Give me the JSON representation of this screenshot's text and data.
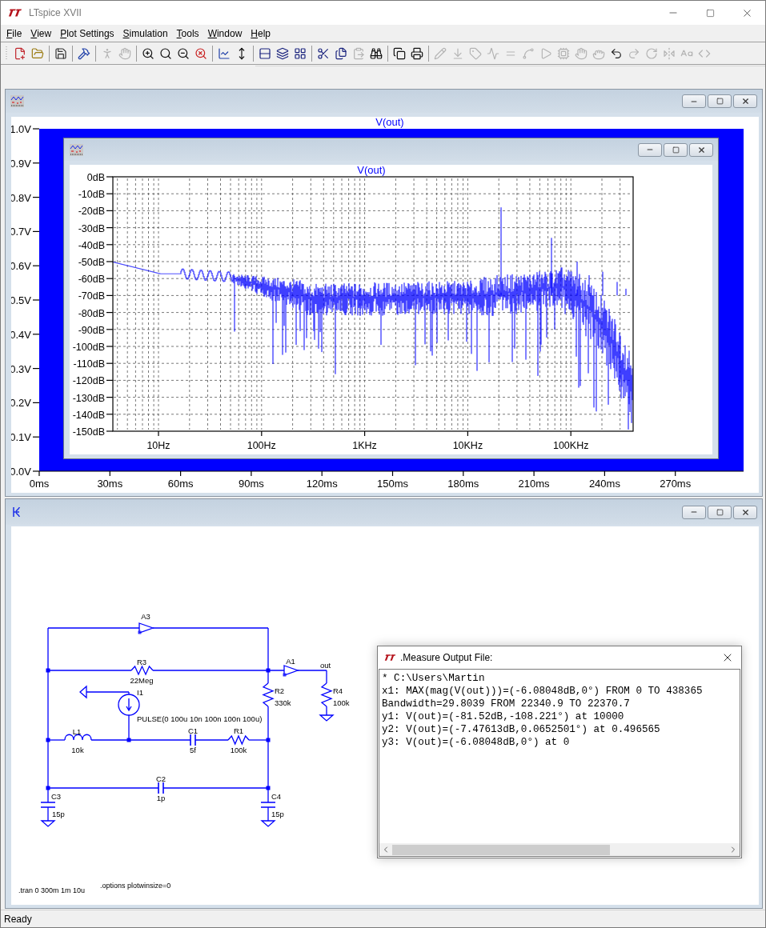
{
  "title_bar": {
    "title": "LTspice XVII"
  },
  "menu": [
    "File",
    "View",
    "Plot Settings",
    "Simulation",
    "Tools",
    "Window",
    "Help"
  ],
  "toolbar": [
    [
      {
        "kind": "new",
        "disabled": false
      },
      {
        "kind": "open",
        "disabled": false
      }
    ],
    [
      {
        "kind": "save",
        "disabled": false
      }
    ],
    [
      {
        "kind": "control-panel",
        "disabled": false
      }
    ],
    [
      {
        "kind": "run",
        "disabled": true
      },
      {
        "kind": "halt",
        "disabled": true
      }
    ],
    [
      {
        "kind": "zoom-in",
        "disabled": false
      },
      {
        "kind": "zoom-fit",
        "disabled": false
      },
      {
        "kind": "zoom-out",
        "disabled": false
      },
      {
        "kind": "zoom-cancel",
        "disabled": false
      }
    ],
    [
      {
        "kind": "add-trace",
        "disabled": false
      },
      {
        "kind": "autorange",
        "disabled": false
      }
    ],
    [
      {
        "kind": "tile",
        "disabled": false
      },
      {
        "kind": "cascade",
        "disabled": false
      },
      {
        "kind": "arrange",
        "disabled": false
      }
    ],
    [
      {
        "kind": "cut",
        "disabled": false
      },
      {
        "kind": "copy",
        "disabled": false
      },
      {
        "kind": "paste",
        "disabled": true
      },
      {
        "kind": "find",
        "disabled": false
      }
    ],
    [
      {
        "kind": "print-preview",
        "disabled": false
      },
      {
        "kind": "print",
        "disabled": false
      }
    ],
    [
      {
        "kind": "wire",
        "disabled": true
      },
      {
        "kind": "ground",
        "disabled": true
      },
      {
        "kind": "label",
        "disabled": true
      },
      {
        "kind": "resistor",
        "disabled": true
      },
      {
        "kind": "capacitor",
        "disabled": true
      },
      {
        "kind": "inductor",
        "disabled": true
      },
      {
        "kind": "diode",
        "disabled": true
      },
      {
        "kind": "component",
        "disabled": true
      },
      {
        "kind": "move",
        "disabled": true
      },
      {
        "kind": "drag",
        "disabled": true
      },
      {
        "kind": "undo",
        "disabled": false
      },
      {
        "kind": "redo",
        "disabled": true
      },
      {
        "kind": "rotate",
        "disabled": true
      },
      {
        "kind": "mirror",
        "disabled": true
      },
      {
        "kind": "text",
        "disabled": true
      },
      {
        "kind": "directive",
        "disabled": true
      }
    ]
  ],
  "plot_window": {
    "trace_label": "V(out)",
    "y_ticks": [
      "1.0V",
      "0.9V",
      "0.8V",
      "0.7V",
      "0.6V",
      "0.5V",
      "0.4V",
      "0.3V",
      "0.2V",
      "0.1V",
      "0.0V"
    ],
    "x_ticks": [
      "0ms",
      "30ms",
      "60ms",
      "90ms",
      "120ms",
      "150ms",
      "180ms",
      "210ms",
      "240ms",
      "270ms"
    ]
  },
  "fft_window": {
    "trace_label": "V(out)",
    "y_ticks": [
      "0dB",
      "-10dB",
      "-20dB",
      "-30dB",
      "-40dB",
      "-50dB",
      "-60dB",
      "-70dB",
      "-80dB",
      "-90dB",
      "-100dB",
      "-110dB",
      "-120dB",
      "-130dB",
      "-140dB",
      "-150dB"
    ],
    "x_ticks": [
      "10Hz",
      "100Hz",
      "1KHz",
      "10KHz",
      "100KHz"
    ]
  },
  "schematic": {
    "components": [
      {
        "kind": "buffer",
        "name": "A3"
      },
      {
        "kind": "resistor",
        "name": "R3",
        "value": "22Meg"
      },
      {
        "kind": "buffer",
        "name": "A1"
      },
      {
        "kind": "current-source",
        "name": "I1",
        "value": "PULSE(0 100u 10n 100n 100n 100u)"
      },
      {
        "kind": "resistor",
        "name": "R2",
        "value": "330k"
      },
      {
        "kind": "resistor",
        "name": "R4",
        "value": "100k"
      },
      {
        "kind": "inductor",
        "name": "L1",
        "value": "10k"
      },
      {
        "kind": "capacitor",
        "name": "C1",
        "value": "5f"
      },
      {
        "kind": "resistor",
        "name": "R1",
        "value": "100k"
      },
      {
        "kind": "capacitor",
        "name": "C2",
        "value": "1p"
      },
      {
        "kind": "capacitor",
        "name": "C3",
        "value": "15p"
      },
      {
        "kind": "capacitor",
        "name": "C4",
        "value": "15p"
      }
    ],
    "net_label": "out",
    "directives": [
      ".tran 0 300m 1m 10u",
      ".options plotwinsize=0"
    ]
  },
  "measure_window": {
    "title": ".Measure Output File:",
    "lines": [
      "* C:\\Users\\Martin",
      "x1: MAX(mag(V(out)))=(-6.08048dB,0°) FROM 0 TO 438365",
      "Bandwidth=29.8039 FROM 22340.9 TO 22370.7",
      "y1: V(out)=(-81.52dB,-108.221°) at 10000",
      "y2: V(out)=(-7.47613dB,0.0652501°) at 0.496565",
      "y3: V(out)=(-6.08048dB,0°) at 0"
    ]
  },
  "status_bar": "Ready"
}
